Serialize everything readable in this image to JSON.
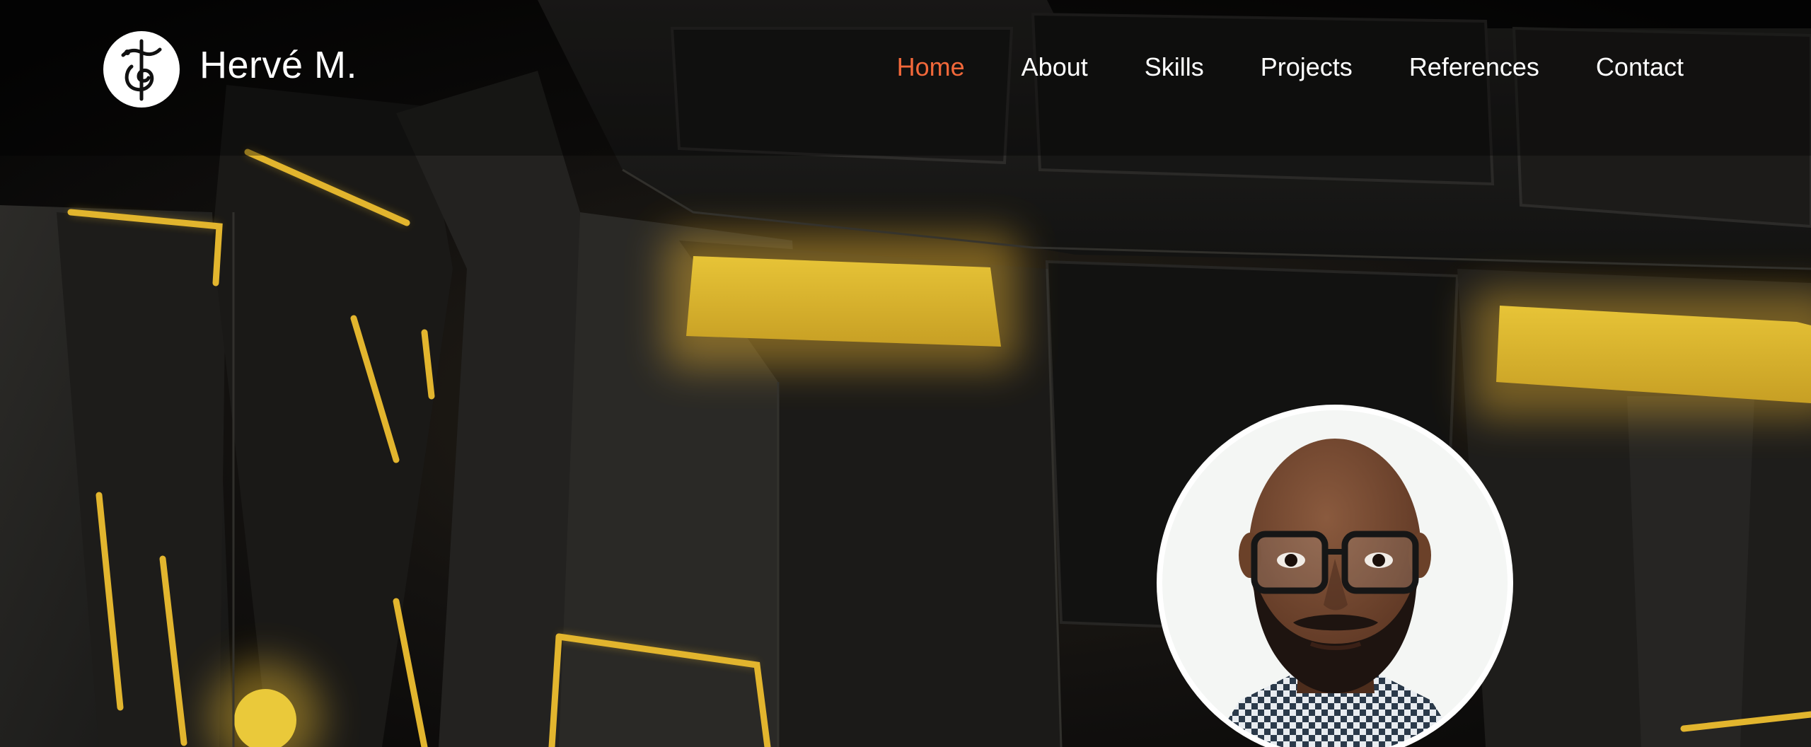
{
  "header": {
    "site_title": "Hervé M.",
    "logo_icon": "monogram-logo-icon"
  },
  "nav": {
    "items": [
      {
        "label": "Home",
        "active": true
      },
      {
        "label": "About",
        "active": false
      },
      {
        "label": "Skills",
        "active": false
      },
      {
        "label": "Projects",
        "active": false
      },
      {
        "label": "References",
        "active": false
      },
      {
        "label": "Contact",
        "active": false
      }
    ]
  },
  "colors": {
    "accent": "#f2683a",
    "nav_text": "#ffffff",
    "background": "#050505",
    "glow": "#e8c63a"
  },
  "hero": {
    "background_image": "dark-robot-with-yellow-glowing-lights",
    "portrait_image": "profile-photo"
  }
}
